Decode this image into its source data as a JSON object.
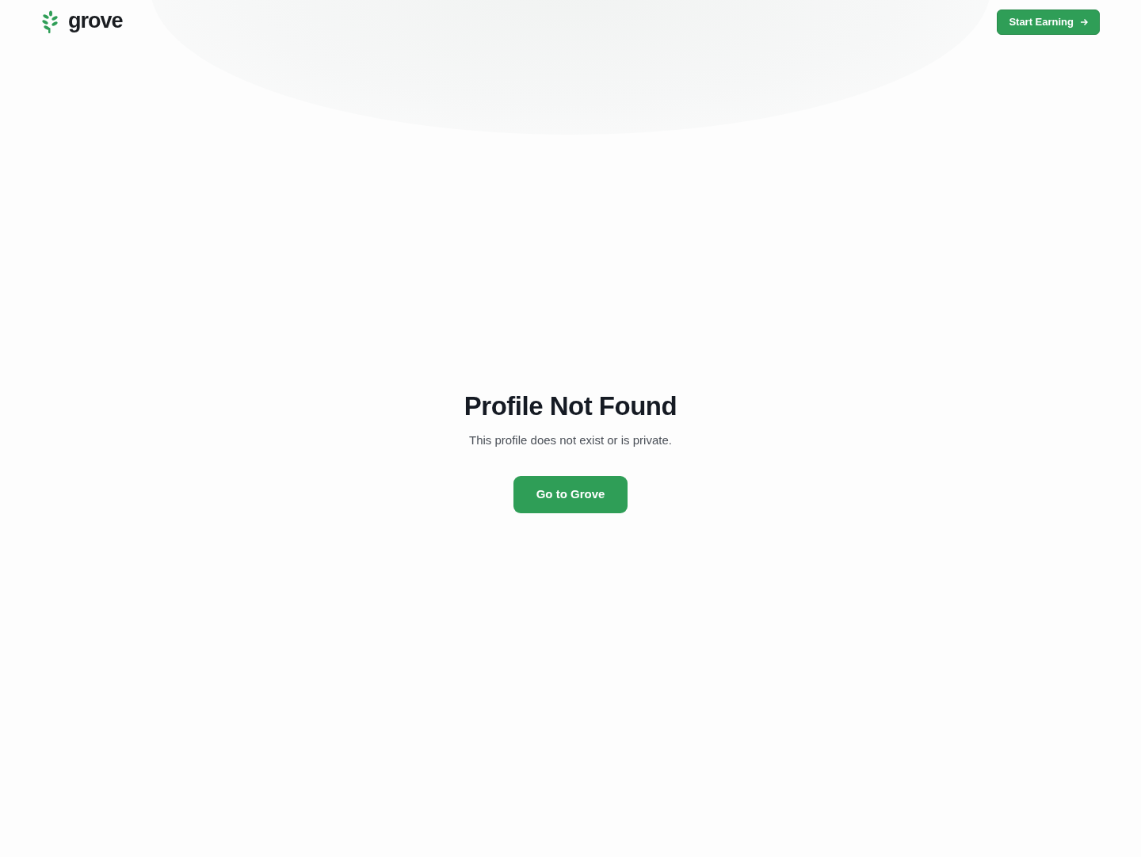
{
  "header": {
    "logo": "grove",
    "cta": "Start Earning"
  },
  "main": {
    "title": "Profile Not Found",
    "message": "This profile does not exist or is private.",
    "button": "Go to Grove"
  }
}
